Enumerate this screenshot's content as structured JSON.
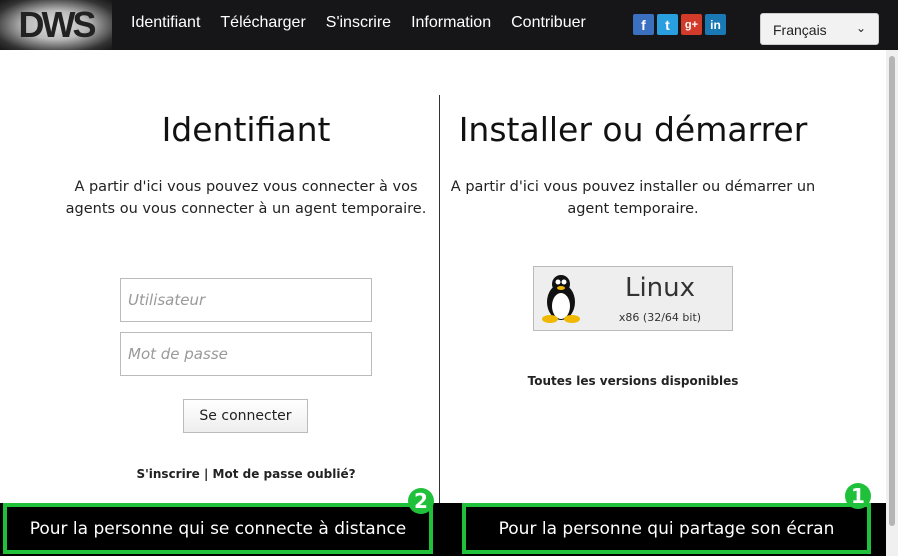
{
  "nav": {
    "logo": "DWS",
    "links": [
      "Identifiant",
      "Télécharger",
      "S'inscrire",
      "Information",
      "Contribuer"
    ],
    "social": [
      "f",
      "t",
      "g+",
      "in"
    ],
    "language": "Français"
  },
  "login": {
    "title": "Identifiant",
    "description": "A partir d'ici vous pouvez vous connecter à vos agents ou vous connecter à un agent temporaire.",
    "username_placeholder": "Utilisateur",
    "password_placeholder": "Mot de passe",
    "connect": "Se connecter",
    "register": "S'inscrire",
    "separator": "|",
    "forgot": "Mot de passe oublié?"
  },
  "install": {
    "title": "Installer ou démarrer",
    "description": "A partir d'ici vous pouvez installer ou démarrer un agent temporaire.",
    "os": "Linux",
    "arch": "x86 (32/64 bit)",
    "all_versions": "Toutes les versions disponibles"
  },
  "annotations": [
    {
      "number": "2",
      "label": "Pour la personne qui se connecte à distance"
    },
    {
      "number": "1",
      "label": "Pour la personne qui partage son écran"
    }
  ],
  "colors": {
    "highlight": "#1fc13a",
    "nav": "#161618"
  }
}
